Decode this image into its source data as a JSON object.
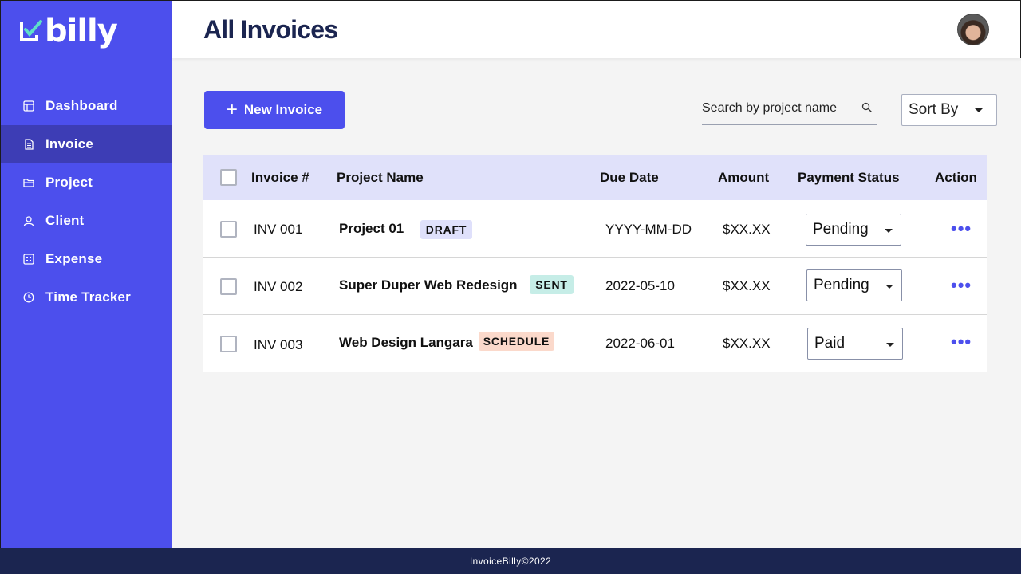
{
  "app": {
    "logo_text": "billy"
  },
  "sidebar": {
    "items": [
      {
        "label": "Dashboard",
        "icon": "dashboard-icon",
        "active": false
      },
      {
        "label": "Invoice",
        "icon": "invoice-icon",
        "active": true
      },
      {
        "label": "Project",
        "icon": "folder-icon",
        "active": false
      },
      {
        "label": "Client",
        "icon": "client-icon",
        "active": false
      },
      {
        "label": "Expense",
        "icon": "calculator-icon",
        "active": false
      },
      {
        "label": "Time Tracker",
        "icon": "clock-icon",
        "active": false
      }
    ]
  },
  "header": {
    "title": "All Invoices"
  },
  "toolbar": {
    "new_invoice_label": "New Invoice",
    "search_placeholder": "Search by project name",
    "sort_label": "Sort By"
  },
  "table": {
    "columns": [
      "Invoice #",
      "Project Name",
      "Due Date",
      "Amount",
      "Payment Status",
      "Action"
    ],
    "rows": [
      {
        "invoice": "INV 001",
        "project": "Project 01",
        "badge": "DRAFT",
        "due": "YYYY-MM-DD",
        "amount": "$XX.XX",
        "status": "Pending"
      },
      {
        "invoice": "INV 002",
        "project": "Super Duper Web Redesign",
        "badge": "SENT",
        "due": "2022-05-10",
        "amount": "$XX.XX",
        "status": "Pending"
      },
      {
        "invoice": "INV 003",
        "project": "Web Design Langara",
        "badge": "SCHEDULE",
        "due": "2022-06-01",
        "amount": "$XX.XX",
        "status": "Paid"
      }
    ],
    "more_glyph": "•••"
  },
  "badge_colors": {
    "DRAFT": "#dfe0fb",
    "SENT": "#c6ede7",
    "SCHEDULE": "#fbd9cb"
  },
  "colors": {
    "primary": "#4c4fed",
    "sidebar_active": "#3d3db5",
    "title": "#1b2550",
    "footer": "#1b2550"
  },
  "footer": {
    "text": "InvoiceBilly©2022"
  }
}
